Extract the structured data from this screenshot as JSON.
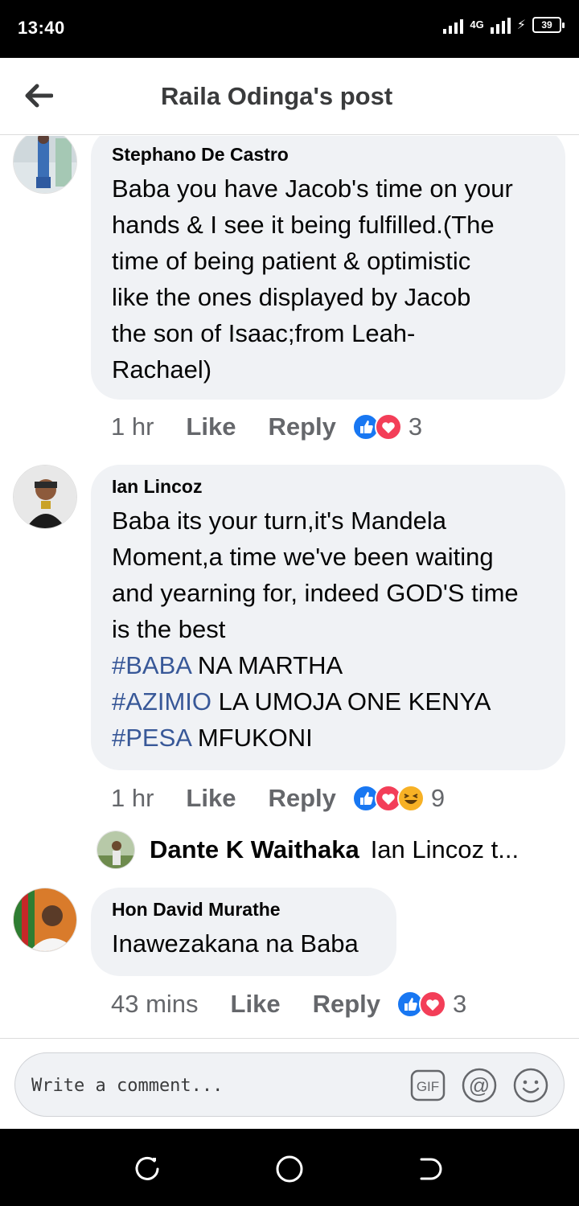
{
  "status_bar": {
    "time": "13:40",
    "network": "4G",
    "battery": "39"
  },
  "header": {
    "title": "Raila Odinga's post",
    "back_icon": "arrow-left-icon"
  },
  "comments": [
    {
      "author": "Stephano De Castro",
      "lines": [
        "Baba you have Jacob's time on your",
        "hands & I see it being fulfilled.(The",
        "time of being patient & optimistic",
        "like the ones displayed by Jacob",
        "the son of Isaac;from Leah-",
        "Rachael)"
      ],
      "time": "1 hr",
      "like": "Like",
      "reply": "Reply",
      "reactions": [
        "like",
        "love"
      ],
      "reaction_count": "3"
    },
    {
      "author": "Ian Lincoz",
      "lines": [
        "Baba its your turn,it's Mandela",
        "Moment,a time we've been waiting",
        "and yearning for, indeed GOD'S time",
        "is the best"
      ],
      "hashtag_lines": [
        {
          "tag": "#BABA",
          "rest": " NA MARTHA"
        },
        {
          "tag": "#AZIMIO",
          "rest": " LA UMOJA ONE KENYA"
        },
        {
          "tag": "#PESA",
          "rest": " MFUKONI"
        }
      ],
      "time": "1 hr",
      "like": "Like",
      "reply": "Reply",
      "reactions": [
        "like",
        "love",
        "haha"
      ],
      "reaction_count": "9",
      "reply_preview": {
        "author": "Dante K Waithaka",
        "text": "Ian Lincoz t..."
      }
    },
    {
      "author": "Hon David Murathe",
      "lines": [
        "Inawezakana na Baba"
      ],
      "time": "43 mins",
      "like": "Like",
      "reply": "Reply",
      "reactions": [
        "like",
        "love"
      ],
      "reaction_count": "3"
    }
  ],
  "composer": {
    "placeholder": "Write a comment...",
    "gif_label": "GIF",
    "mention_label": "@"
  },
  "colors": {
    "bubble": "#f0f2f5",
    "hashtag": "#385898",
    "like_blue": "#1877f2",
    "love_red": "#f33e58",
    "haha_yellow": "#f7b125"
  }
}
